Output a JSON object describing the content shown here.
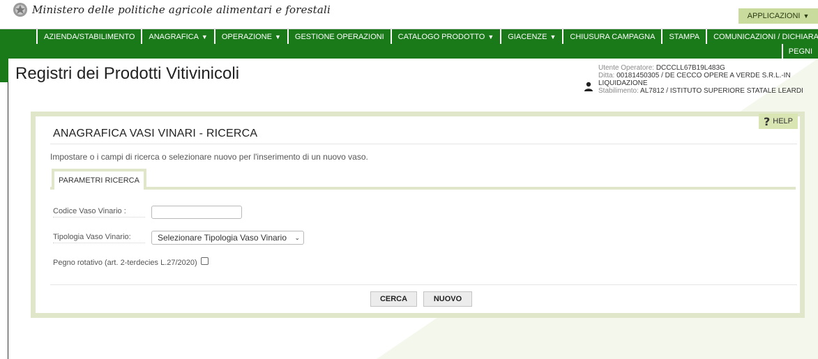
{
  "header": {
    "ministry_name": "Ministero delle politiche agricole alimentari e forestali",
    "applications_label": "APPLICAZIONI"
  },
  "nav": {
    "items": [
      {
        "label": "AZIENDA/STABILIMENTO",
        "dropdown": false
      },
      {
        "label": "ANAGRAFICA",
        "dropdown": true
      },
      {
        "label": "OPERAZIONE",
        "dropdown": true
      },
      {
        "label": "GESTIONE OPERAZIONI",
        "dropdown": false
      },
      {
        "label": "CATALOGO PRODOTTO",
        "dropdown": true
      },
      {
        "label": "GIACENZE",
        "dropdown": true
      },
      {
        "label": "CHIUSURA CAMPAGNA",
        "dropdown": false
      },
      {
        "label": "STAMPA",
        "dropdown": false
      },
      {
        "label": "COMUNICAZIONI / DICHIARAZIONI",
        "dropdown": false
      }
    ],
    "second_row_item": "PEGNI",
    "caret": "▼"
  },
  "page": {
    "title": "Registri dei Prodotti Vitivinicoli"
  },
  "user": {
    "operator_label": "Utente Operatore:",
    "operator_value": "DCCCLL67B19L483G",
    "ditta_label": "Ditta:",
    "ditta_value": "00181450305 / DE CECCO OPERE A VERDE S.R.L.-IN LIQUIDAZIONE",
    "stabilimento_label": "Stabilimento:",
    "stabilimento_value": "AL7812 / ISTITUTO SUPERIORE STATALE LEARDI"
  },
  "panel": {
    "help_label": "HELP",
    "title": "ANAGRAFICA VASI VINARI - RICERCA",
    "intro": "Impostare o i campi di ricerca o selezionare nuovo per l'inserimento di un nuovo vaso.",
    "tab_label": "PARAMETRI RICERCA"
  },
  "form": {
    "codice_label": "Codice Vaso Vinario :",
    "codice_value": "",
    "tipologia_label": "Tipologia Vaso Vinario:",
    "tipologia_selected": "Selezionare Tipologia Vaso Vinario",
    "pegno_label": "Pegno rotativo (art. 2-terdecies L.27/2020)",
    "pegno_checked": false
  },
  "buttons": {
    "cerca": "CERCA",
    "nuovo": "NUOVO"
  },
  "colors": {
    "nav_green": "#1a7a1a",
    "panel_border": "#dfe6c9",
    "app_button": "#c9dc9d"
  }
}
